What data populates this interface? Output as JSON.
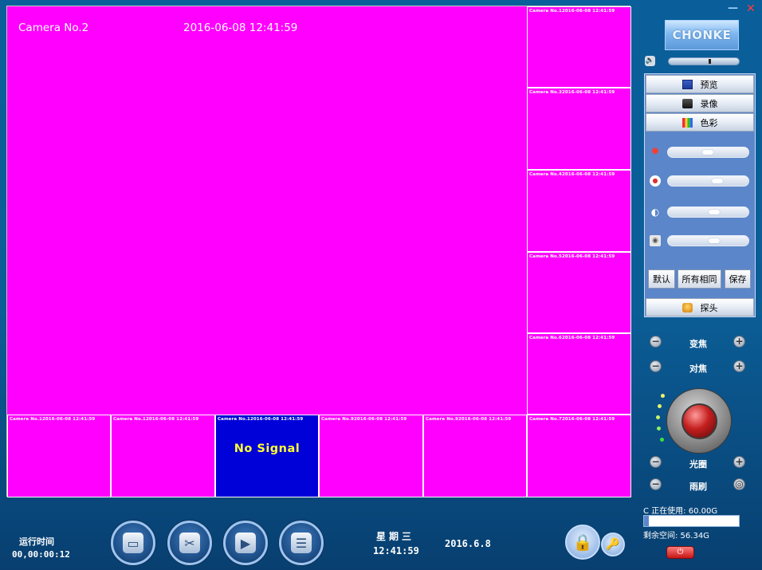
{
  "window": {
    "minimize_icon": "minimize-icon",
    "close_icon": "close-icon"
  },
  "main_view": {
    "camera_name": "Camera No.2",
    "timestamp": "2016-06-08 12:41:59"
  },
  "side_tiles": [
    "Camera No.12016-06-08 12:41:59",
    "Camera No.32016-06-08 12:41:59",
    "Camera No.42016-06-08 12:41:59",
    "Camera No.52016-06-08 12:41:59",
    "Camera No.62016-06-08 12:41:59",
    "Camera No.72016-06-08 12:41:59"
  ],
  "bottom_tiles": [
    {
      "label": "Camera No.12016-06-08 12:41:59",
      "status": ""
    },
    {
      "label": "Camera No.12016-06-08 12:41:59",
      "status": ""
    },
    {
      "label": "Camera No.12016-06-08 12:41:59",
      "status": "No Signal"
    },
    {
      "label": "Camera No.92016-06-08 12:41:59",
      "status": ""
    },
    {
      "label": "Camera No.92016-06-08 12:41:59",
      "status": ""
    }
  ],
  "brand": {
    "logo_text": "CHONKE"
  },
  "volume": {
    "level": 0.58
  },
  "panel": {
    "preview_label": "预览",
    "record_label": "录像",
    "color_label": "色彩",
    "ptz_label": "探头",
    "default_label": "默认",
    "all_same_label": "所有相同",
    "save_label": "保存"
  },
  "adjustments": {
    "brightness": 0.5,
    "contrast": 0.65,
    "saturation": 0.6,
    "hue": 0.6
  },
  "ptz": {
    "zoom_label": "变焦",
    "focus_label": "对焦",
    "iris_label": "光圈",
    "wiper_label": "雨刷"
  },
  "disk": {
    "usage_text": "C 正在使用: 60.00G",
    "free_text": "剩余空间: 56.34G",
    "used_fraction": 0.05
  },
  "status": {
    "runtime_title": "运行时间",
    "runtime_value": "00,00:00:12",
    "weekday": "星期三",
    "time": "12:41:59",
    "date": "2016.6.8"
  },
  "colors": {
    "video_bg": "#ff00ff",
    "no_signal_bg": "#0000d8",
    "no_signal_text": "#ffff33",
    "panel_bg": "#5b86c9"
  }
}
